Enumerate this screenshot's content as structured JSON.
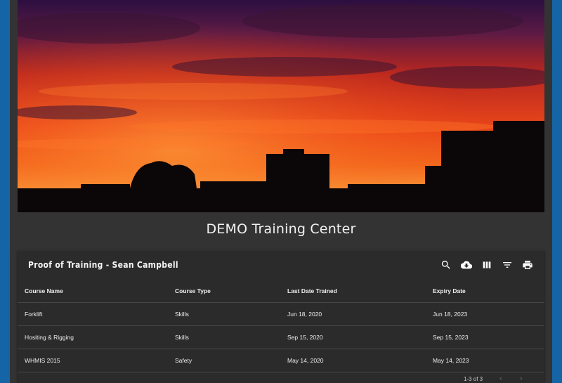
{
  "header": {
    "title": "DEMO Training Center"
  },
  "hero": {
    "image": "sunset-city-skyline"
  },
  "card": {
    "title": "Proof of Training - Sean Campbell",
    "toolbar": [
      {
        "icon": "search-icon"
      },
      {
        "icon": "download-icon"
      },
      {
        "icon": "columns-icon"
      },
      {
        "icon": "filter-icon"
      },
      {
        "icon": "print-icon"
      }
    ],
    "columns": [
      "Course Name",
      "Course Type",
      "Last Date Trained",
      "Expiry Date"
    ],
    "rows": [
      [
        "Forklift",
        "Skills",
        "Jun 18, 2020",
        "Jun 18, 2023"
      ],
      [
        "Hositing & Rigging",
        "Skills",
        "Sep 15, 2020",
        "Sep 15, 2023"
      ],
      [
        "WHMIS 2015",
        "Safety",
        "May 14, 2020",
        "May 14, 2023"
      ]
    ],
    "pagination": {
      "info": "1-3 of 3",
      "prev": "‹",
      "next": "›"
    }
  },
  "colors": {
    "page_bg": "#1565a6",
    "panel_bg": "#333333",
    "card_bg": "#2b2b2b"
  }
}
